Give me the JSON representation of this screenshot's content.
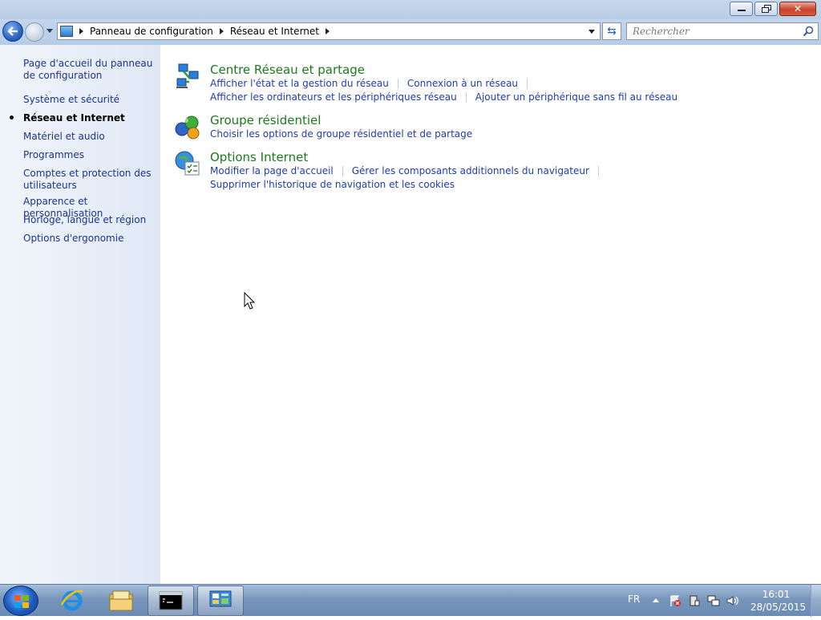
{
  "addressbar": {
    "crumbs": [
      "Panneau de configuration",
      "Réseau et Internet"
    ],
    "search_placeholder": "Rechercher"
  },
  "sidebar": {
    "items": [
      {
        "label": "Page d'accueil du panneau de configuration"
      },
      {
        "label": "Système et sécurité"
      },
      {
        "label": "Réseau et Internet",
        "current": true
      },
      {
        "label": "Matériel et audio"
      },
      {
        "label": "Programmes"
      },
      {
        "label": "Comptes et protection des utilisateurs"
      },
      {
        "label": "Apparence et personnalisation"
      },
      {
        "label": "Horloge, langue et région"
      },
      {
        "label": "Options d'ergonomie"
      }
    ]
  },
  "categories": [
    {
      "title": "Centre Réseau et partage",
      "icon": "network-icon",
      "links": [
        [
          "Afficher l'état et la gestion du réseau",
          "Connexion à un réseau"
        ],
        [
          "Afficher les ordinateurs et les périphériques réseau",
          "Ajouter un périphérique sans fil au réseau"
        ]
      ]
    },
    {
      "title": "Groupe résidentiel",
      "icon": "homegroup-icon",
      "links": [
        [
          "Choisir les options de groupe résidentiel et de partage"
        ]
      ]
    },
    {
      "title": "Options Internet",
      "icon": "internet-options-icon",
      "links": [
        [
          "Modifier la page d'accueil",
          "Gérer les composants additionnels du navigateur"
        ],
        [
          "Supprimer l'historique de navigation et les cookies"
        ]
      ]
    }
  ],
  "taskbar": {
    "language": "FR",
    "time": "16:01",
    "date": "28/05/2015",
    "apps": [
      "internet-explorer-icon",
      "explorer-folder-icon",
      "command-prompt-icon",
      "control-panel-icon"
    ]
  },
  "colors": {
    "category_title": "#1b7a1b",
    "link": "#1e3ea8",
    "sidebar_link": "#1e3287"
  }
}
